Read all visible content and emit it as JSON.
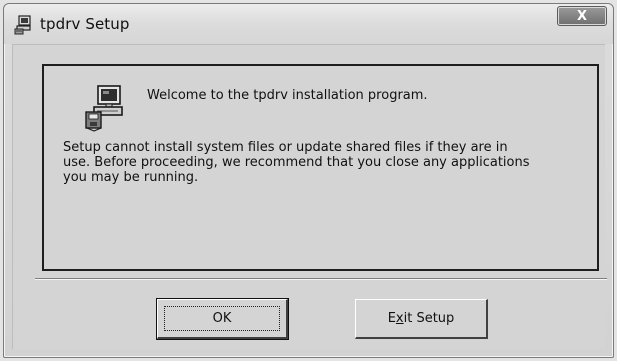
{
  "window": {
    "title": "tpdrv Setup",
    "close_label": "X"
  },
  "panel": {
    "welcome": "Welcome to the tpdrv installation program.",
    "message_lines": [
      "Setup cannot install system files or update shared files if they are in",
      "use. Before proceeding, we recommend that you close any applications",
      "you may be running."
    ]
  },
  "buttons": {
    "ok_label": "OK",
    "exit_prefix": "E",
    "exit_mnemonic": "x",
    "exit_suffix": "it Setup"
  },
  "icons": {
    "app": "setup-computer-icon",
    "welcome": "setup-computer-icon"
  }
}
